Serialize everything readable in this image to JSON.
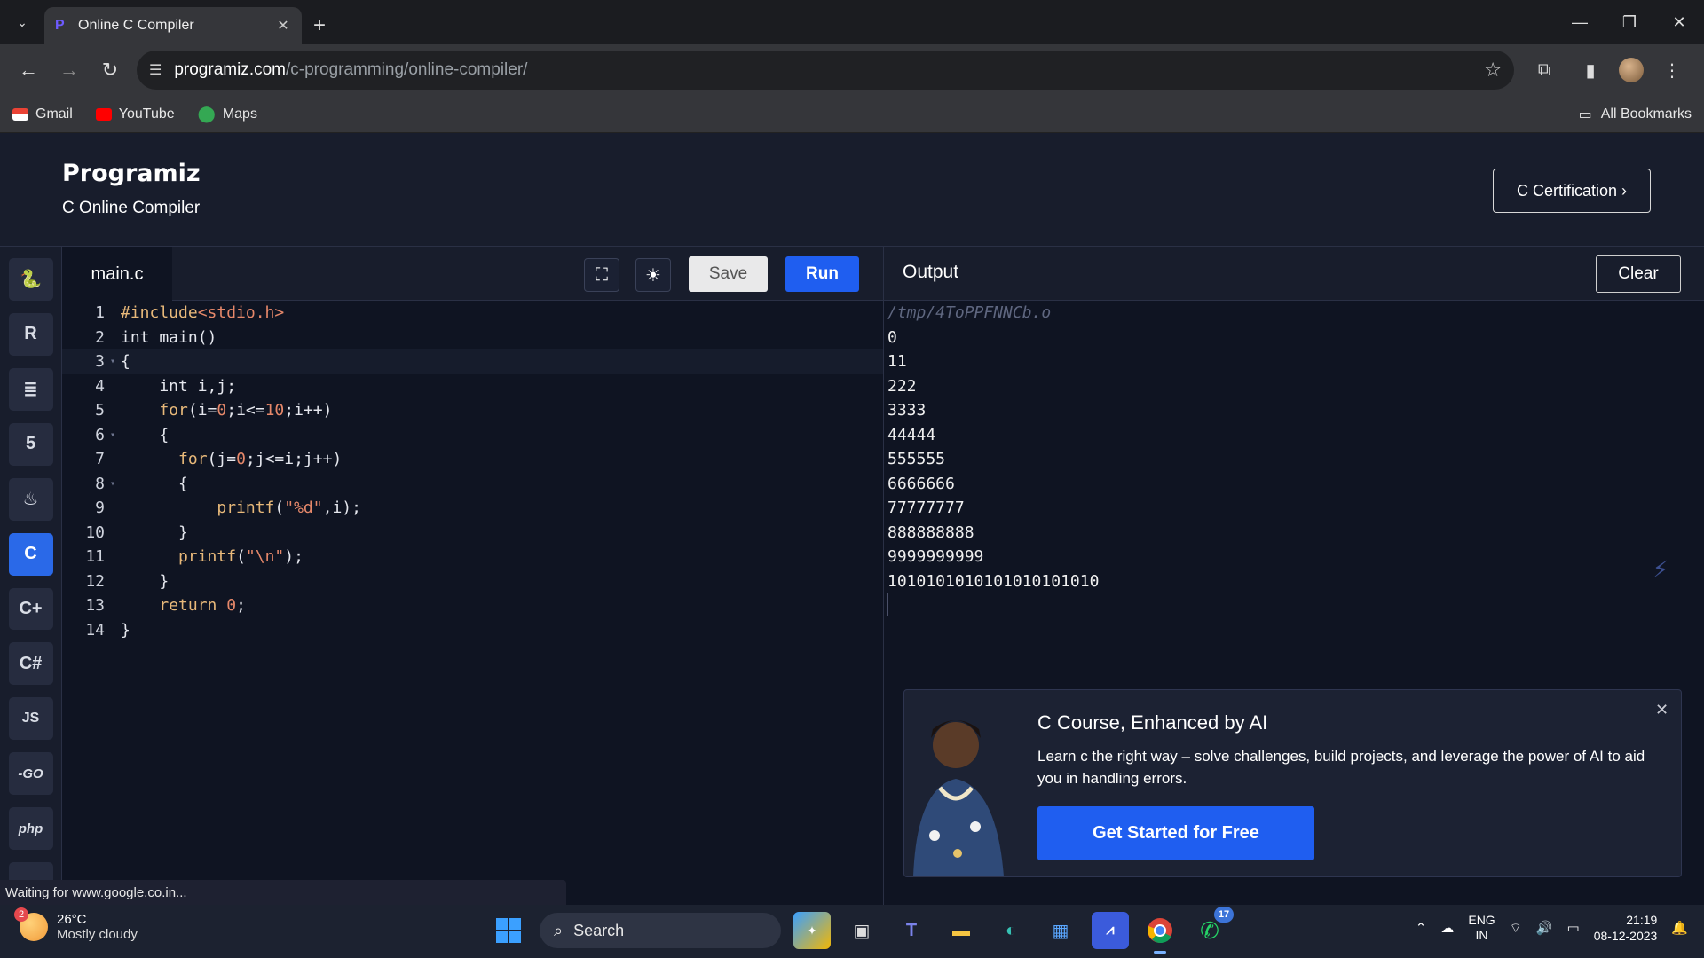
{
  "browser": {
    "tab_title": "Online C Compiler",
    "url_host": "programiz.com",
    "url_path": "/c-programming/online-compiler/",
    "bookmarks": [
      {
        "label": "Gmail"
      },
      {
        "label": "YouTube"
      },
      {
        "label": "Maps"
      }
    ],
    "all_bookmarks": "All Bookmarks"
  },
  "site": {
    "logo": "Programiz",
    "subtitle": "C Online Compiler",
    "cert_button": "C Certification ›"
  },
  "languages": [
    "python-icon",
    "r-icon",
    "sql-icon",
    "html5-icon",
    "java-icon",
    "c-icon",
    "cpp-icon",
    "csharp-icon",
    "js-icon",
    "go-icon",
    "php-icon",
    "more-icon"
  ],
  "lang_labels": {
    "js": "JS",
    "go": "-GO",
    "php": "php"
  },
  "editor": {
    "file_tab": "main.c",
    "save_label": "Save",
    "run_label": "Run",
    "lines": [
      "#include<stdio.h>",
      "int main()",
      "{",
      "    int i,j;",
      "    for(i=0;i<=10;i++)",
      "    {",
      "      for(j=0;j<=i;j++)",
      "      {",
      "          printf(\"%d\",i);",
      "      }",
      "      printf(\"\\n\");",
      "    }",
      "    return 0;",
      "}"
    ]
  },
  "output": {
    "title": "Output",
    "clear_label": "Clear",
    "path_line": "/tmp/4ToPPFNNCb.o",
    "lines": [
      "0",
      "11",
      "222",
      "3333",
      "44444",
      "555555",
      "6666666",
      "77777777",
      "888888888",
      "9999999999",
      "1010101010101010101010"
    ]
  },
  "promo": {
    "title": "C Course, Enhanced by AI",
    "text": "Learn c the right way – solve challenges, build projects, and leverage the power of AI to aid you in handling errors.",
    "cta": "Get Started for Free"
  },
  "status_text": "Waiting for www.google.co.in...",
  "taskbar": {
    "weather_temp": "26°C",
    "weather_desc": "Mostly cloudy",
    "weather_badge": "2",
    "search_label": "Search",
    "whatsapp_badge": "17",
    "lang_line1": "ENG",
    "lang_line2": "IN",
    "time": "21:19",
    "date": "08-12-2023"
  },
  "colors": {
    "accent": "#1f5ef0",
    "bg": "#0f1422",
    "panel": "#181d2c"
  }
}
